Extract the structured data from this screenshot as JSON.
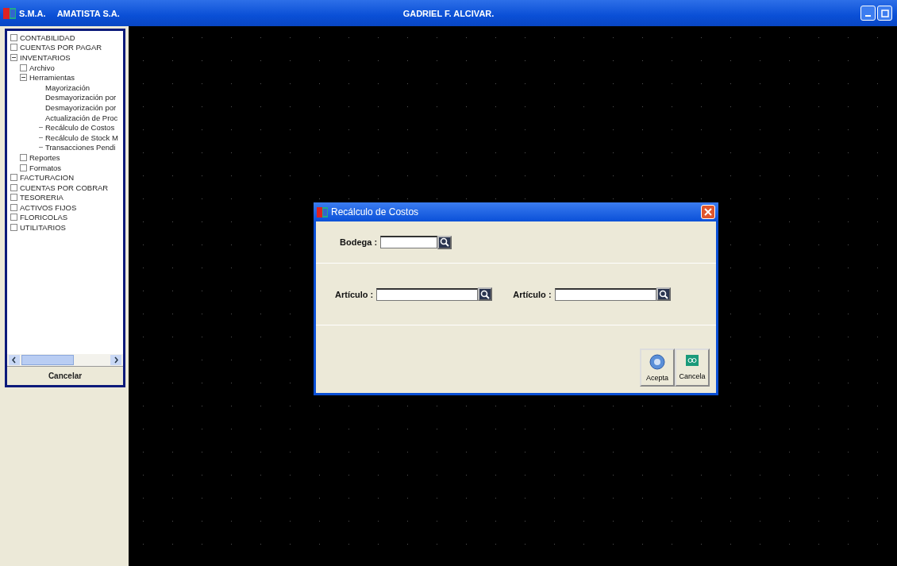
{
  "window": {
    "app": "S.M.A.",
    "company": "AMATISTA S.A.",
    "user": "GADRIEL F. ALCIVAR."
  },
  "tree": [
    {
      "label": "CONTABILIDAD",
      "kind": "node"
    },
    {
      "label": "CUENTAS POR PAGAR",
      "kind": "node"
    },
    {
      "label": "INVENTARIOS",
      "kind": "node",
      "children": [
        {
          "label": "Archivo",
          "kind": "node"
        },
        {
          "label": "Herramientas",
          "kind": "node",
          "children": [
            {
              "label": "Mayorización",
              "kind": "leaf"
            },
            {
              "label": "Desmayorización por",
              "kind": "leaf"
            },
            {
              "label": "Desmayorización por",
              "kind": "leaf"
            },
            {
              "label": "Actualización de Proc",
              "kind": "leaf"
            },
            {
              "label": "Recálculo de Costos",
              "kind": "dash"
            },
            {
              "label": "Recálculo de Stock M",
              "kind": "dash"
            },
            {
              "label": "Transacciones Pendi",
              "kind": "dash"
            }
          ]
        },
        {
          "label": "Reportes",
          "kind": "node"
        },
        {
          "label": "Formatos",
          "kind": "node"
        }
      ]
    },
    {
      "label": "FACTURACION",
      "kind": "node"
    },
    {
      "label": "CUENTAS POR COBRAR",
      "kind": "node"
    },
    {
      "label": "TESORERIA",
      "kind": "node"
    },
    {
      "label": "ACTIVOS FIJOS",
      "kind": "node"
    },
    {
      "label": "FLORICOLAS",
      "kind": "node"
    },
    {
      "label": "UTILITARIOS",
      "kind": "node"
    }
  ],
  "sidebar_button": "Cancelar",
  "dialog": {
    "title": "Recálculo de Costos",
    "bodega_label": "Bodega :",
    "articulo_from_label": "Artículo :",
    "articulo_to_label": "Artículo :",
    "buttons": [
      {
        "label": "Acepta",
        "kind": "accept"
      },
      {
        "label": "Cancela",
        "kind": "cancel"
      }
    ]
  }
}
